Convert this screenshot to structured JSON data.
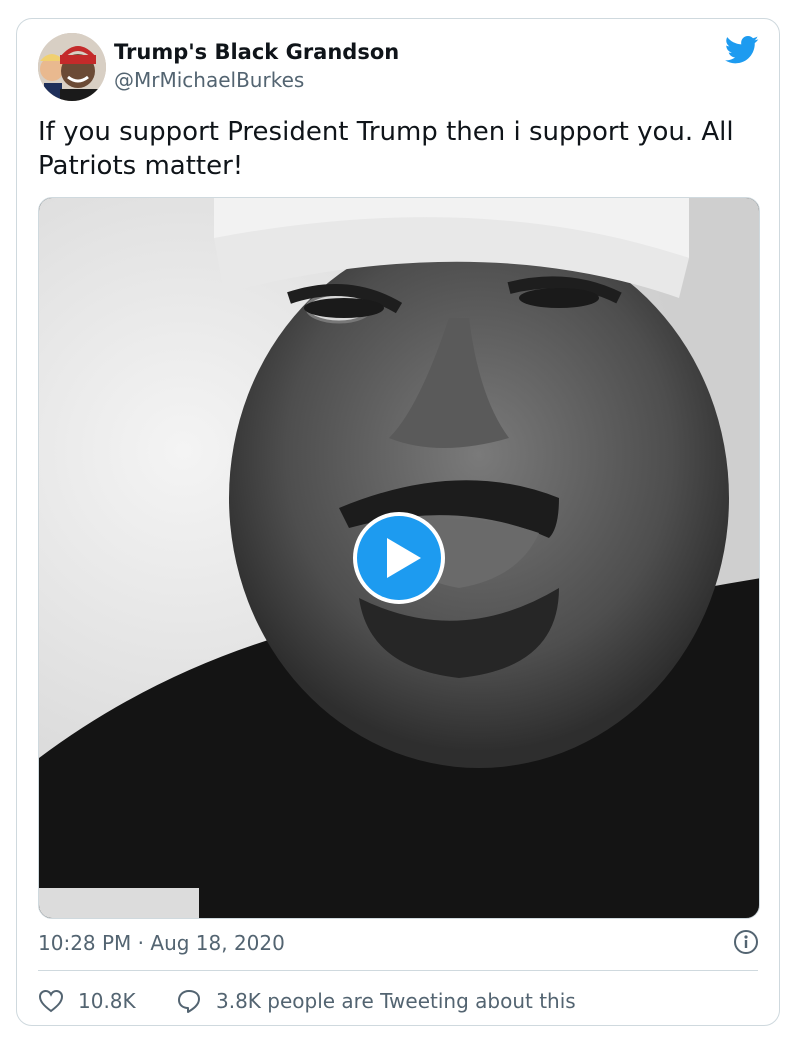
{
  "tweet": {
    "display_name": "Trump's Black Grandson",
    "handle": "@MrMichaelBurkes",
    "text": "If you support President Trump then i support you. All Patriots matter!",
    "timestamp": "10:28 PM · Aug 18, 2020",
    "likes": "10.8K",
    "conversation": "3.8K people are Tweeting about this"
  },
  "icons": {
    "brand": "twitter-bird-icon",
    "play": "play-icon",
    "info": "info-icon",
    "like": "heart-icon",
    "reply": "speech-bubble-icon"
  },
  "colors": {
    "brand_blue": "#1d9bf0",
    "text_primary": "#0f1419",
    "text_secondary": "#536471",
    "border": "#cfd9de"
  }
}
